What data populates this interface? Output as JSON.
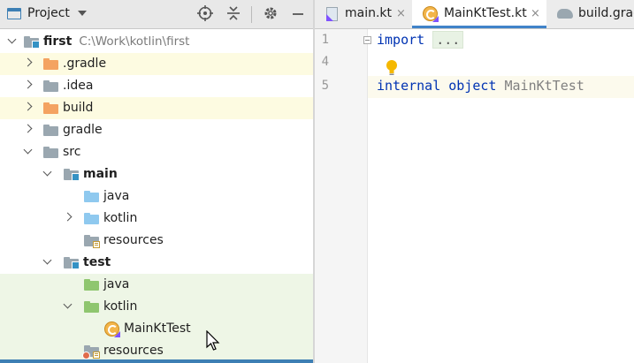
{
  "project_panel": {
    "title": "Project",
    "tools": [
      "locate-icon",
      "collapse-all-icon",
      "settings-gear-icon",
      "hide-icon"
    ]
  },
  "tree": {
    "root": {
      "name": "first",
      "path": "C:\\Work\\kotlin\\first"
    },
    "items": [
      {
        "label": ".gradle"
      },
      {
        "label": ".idea"
      },
      {
        "label": "build"
      },
      {
        "label": "gradle"
      },
      {
        "label": "src"
      },
      {
        "label": "main"
      },
      {
        "label": "java"
      },
      {
        "label": "kotlin"
      },
      {
        "label": "resources"
      },
      {
        "label": "test"
      },
      {
        "label": "java"
      },
      {
        "label": "kotlin"
      },
      {
        "label": "MainKtTest"
      },
      {
        "label": "resources"
      }
    ]
  },
  "editor": {
    "tabs": [
      {
        "label": "main.kt",
        "close": "×"
      },
      {
        "label": "MainKtTest.kt",
        "close": "×"
      },
      {
        "label": "build.gradle"
      }
    ],
    "line_numbers": [
      "1",
      "4",
      "5"
    ],
    "code": {
      "line1_kw": "import",
      "line1_fold": "...",
      "line5_kw1": "internal",
      "line5_kw2": "object",
      "line5_name": "MainKtTest"
    }
  },
  "colors": {
    "accent": "#3d7fb4",
    "keyword": "#0033b3",
    "excluded_folder": "#f4a361",
    "test_highlight": "#eef6e6"
  }
}
